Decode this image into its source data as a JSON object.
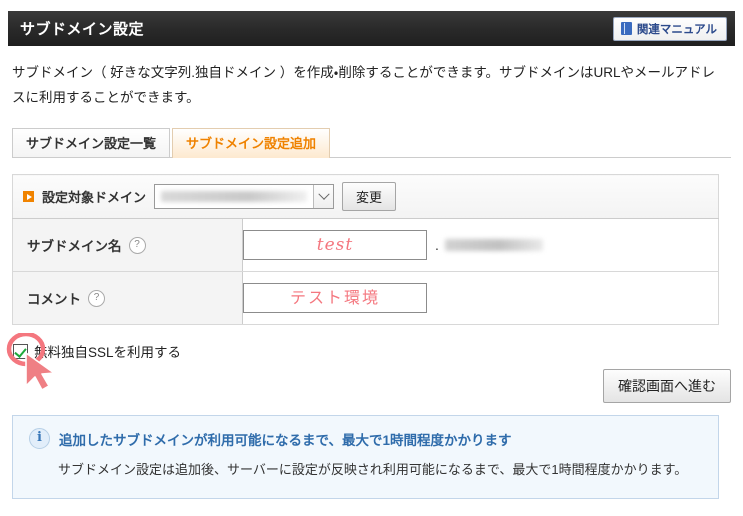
{
  "header": {
    "title": "サブドメイン設定",
    "manual_button": {
      "label": "関連マニュアル",
      "icon": "book-icon"
    }
  },
  "description": "サブドメイン（ 好きな文字列.独自ドメイン ）を作成・削除することができます。サブドメインはURLやメールアドレスに利用することができます。",
  "tabs": [
    {
      "label": "サブドメイン設定一覧",
      "active": false
    },
    {
      "label": "サブドメイン設定追加",
      "active": true
    }
  ],
  "form": {
    "domain_row": {
      "icon": "orange-arrow-icon",
      "label": "設定対象ドメイン",
      "select_value": "",
      "change_button": "変更"
    },
    "fields": [
      {
        "label": "サブドメイン名",
        "help_icon": "question-mark-icon",
        "value": "test",
        "suffix_separator": ".",
        "suffix_value": ""
      },
      {
        "label": "コメント",
        "help_icon": "question-mark-icon",
        "value": "テスト環境"
      }
    ],
    "ssl_checkbox": {
      "label": "無料独自SSLを利用する",
      "checked": true
    },
    "submit_button": "確認画面へ進む"
  },
  "notice": {
    "icon": "info-icon",
    "title": "追加したサブドメインが利用可能になるまで、最大で1時間程度かかります",
    "body": "サブドメイン設定は追加後、サーバーに設定が反映され利用可能になるまで、最大で1時間程度かかります。"
  },
  "colors": {
    "header_bg": "#2a2a2a",
    "accent_orange": "#ef8200",
    "annotation_pink": "#f4777f",
    "notice_blue": "#2f6cab",
    "check_green": "#1faa3c"
  }
}
